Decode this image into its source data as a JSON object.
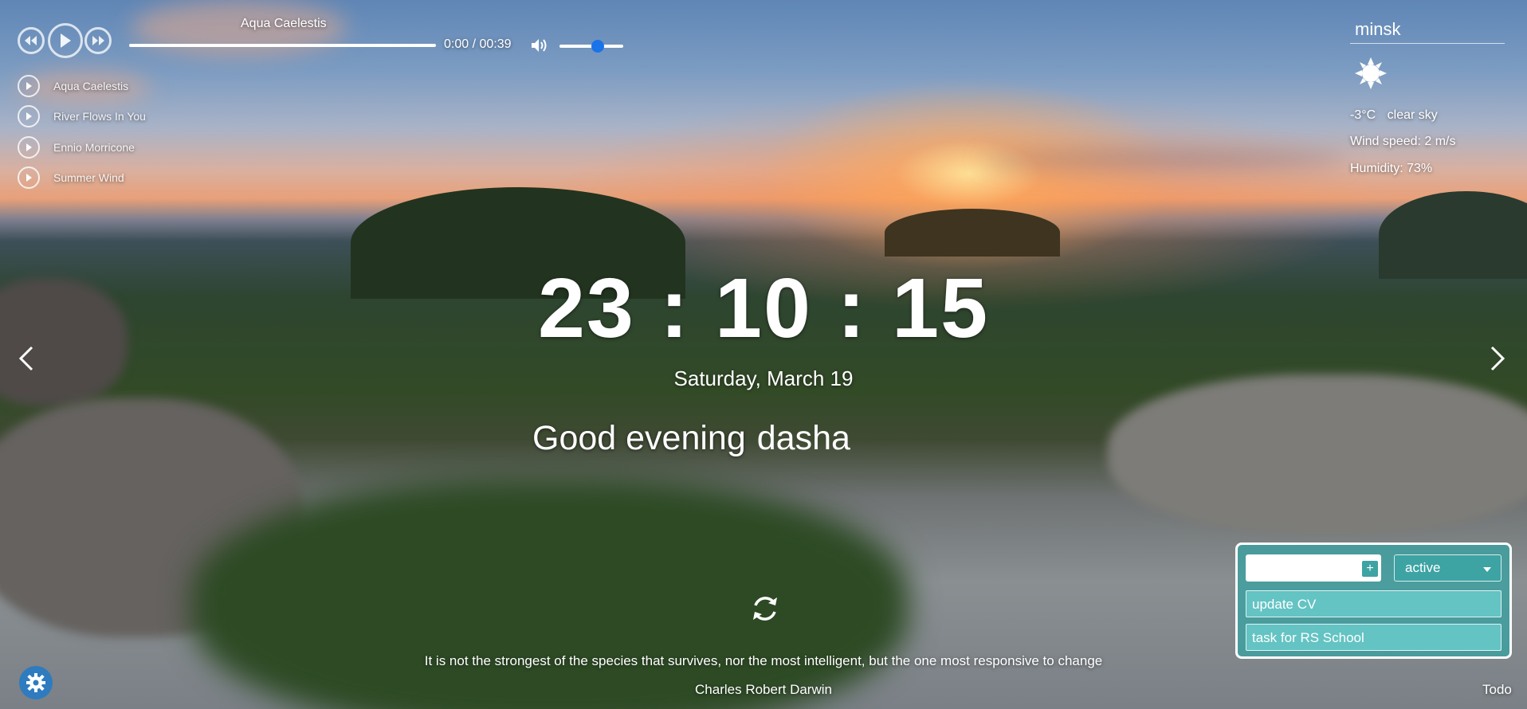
{
  "player": {
    "current_title": "Aqua Caelestis",
    "time": "0:00 / 00:39",
    "volume": 0.6,
    "progress": 0,
    "playlist": [
      "Aqua Caelestis",
      "River Flows In You",
      "Ennio Morricone",
      "Summer Wind"
    ]
  },
  "weather": {
    "city": "minsk",
    "icon": "sun-icon",
    "temperature": "-3°C",
    "description": "clear sky",
    "wind": "Wind speed: 2 m/s",
    "humidity": "Humidity: 73%"
  },
  "clock": {
    "time": "23 : 10 : 15",
    "date": "Saturday, March 19"
  },
  "greeting": {
    "text": "Good evening",
    "name": "dasha"
  },
  "quote": {
    "text": "It is not the strongest of the species that survives, nor the most intelligent, but the one most responsive to change",
    "author": "Charles Robert Darwin"
  },
  "todo": {
    "filter": "active",
    "add_label": "+",
    "items": [
      "update CV",
      "task for RS School"
    ],
    "toggle_label": "Todo"
  },
  "icons": {
    "settings": "gear-icon",
    "prev": "arrow-left-icon",
    "next": "arrow-right-icon",
    "refresh": "refresh-icon"
  },
  "colors": {
    "settings_bg": "#2e7bbf",
    "todo_bg": "#3aa2a2",
    "volume_thumb": "#1a73e8"
  }
}
